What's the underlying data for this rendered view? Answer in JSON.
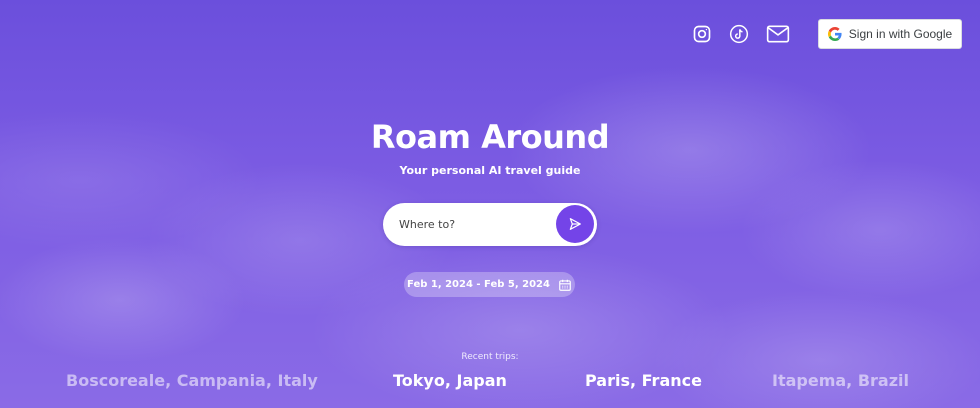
{
  "header": {
    "icons": [
      "instagram-icon",
      "tiktok-icon",
      "mail-icon"
    ],
    "google_signin_label": "Sign in with Google"
  },
  "hero": {
    "title": "Roam Around",
    "subtitle": "Your personal AI travel guide"
  },
  "search": {
    "placeholder": "Where to?",
    "value": ""
  },
  "dates": {
    "range": "Feb 1, 2024 - Feb 5, 2024"
  },
  "recent": {
    "label": "Recent trips:",
    "trips": [
      "Boscoreale, Campania, Italy",
      "Tokyo, Japan",
      "Paris, France",
      "Itapema, Brazil"
    ]
  },
  "colors": {
    "background": "#7a58e0",
    "accent": "#7444e8"
  }
}
